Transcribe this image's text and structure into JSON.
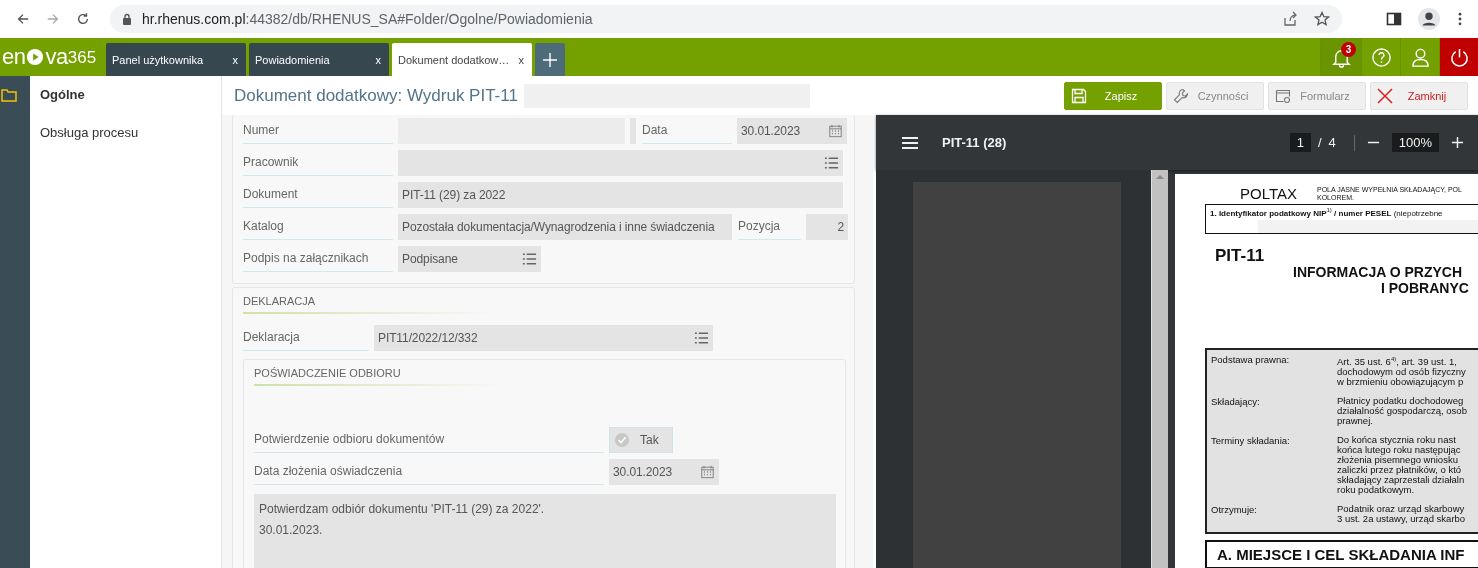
{
  "browser": {
    "url_host": "hr.rhenus.com.pl",
    "url_path": ":44382/db/RHENUS_SA#Folder/Ogolne/Powiadomienia"
  },
  "app_bar": {
    "logo": {
      "left": "en",
      "right": "va",
      "suffix": "365"
    },
    "tabs": [
      {
        "label": "Panel użytkownika",
        "close": "x",
        "selected": false
      },
      {
        "label": "Powiadomienia",
        "close": "x",
        "selected": false
      },
      {
        "label": "Dokument dodatkow…",
        "close": "x",
        "selected": true
      }
    ],
    "notifications": {
      "count": "3"
    }
  },
  "sidebar": {
    "items": [
      {
        "label": "Ogólne",
        "selected": true
      },
      {
        "label": "Obsługa procesu",
        "selected": false
      }
    ]
  },
  "header": {
    "title": "Dokument dodatkowy: Wydruk PIT-11",
    "buttons": [
      {
        "label": "Zapisz",
        "kind": "save"
      },
      {
        "label": "Czynności",
        "kind": "tools"
      },
      {
        "label": "Formularz",
        "kind": "form"
      },
      {
        "label": "Zamknij",
        "kind": "close"
      }
    ]
  },
  "form": {
    "rows": [
      [
        {
          "label": "Numer",
          "kind": "text"
        },
        {
          "label": "Data",
          "kind": "date",
          "value": "30.01.2023"
        }
      ],
      [
        {
          "label": "Pracownik",
          "kind": "lookup"
        }
      ],
      [
        {
          "label": "Dokument",
          "kind": "text",
          "value": "PIT-11 (29) za 2022"
        }
      ],
      [
        {
          "label": "Katalog",
          "kind": "text",
          "value": "Pozostała dokumentacja/Wynagrodzenia i inne świadczenia"
        },
        {
          "label": "Pozycja",
          "kind": "number",
          "value": "2"
        }
      ],
      [
        {
          "label": "Podpis na załącznikach",
          "kind": "lookup",
          "value": "Podpisane"
        }
      ]
    ],
    "declaration": {
      "title": "DEKLARACJA",
      "field": {
        "label": "Deklaracja",
        "kind": "lookup",
        "value": "PIT11/2022/12/332"
      },
      "receipt": {
        "title": "POŚWIADCZENIE ODBIORU",
        "fields": [
          {
            "label": "Potwierdzenie odbioru dokumentów",
            "kind": "checkbox",
            "value": "Tak",
            "checked": true
          },
          {
            "label": "Data złożenia oświadczenia",
            "kind": "date",
            "value": "30.01.2023"
          }
        ],
        "note": [
          "Potwierdzam odbiór dokumentu 'PIT-11 (29) za 2022'.",
          "30.01.2023."
        ]
      }
    }
  },
  "pdf_viewer": {
    "title": "PIT-11 (28)",
    "page": "1",
    "page_separator": "/",
    "page_total": "4",
    "zoom": "100%",
    "document": {
      "brand": "POLTAX",
      "note": [
        "POLA JASNE WYPEŁNIA SKŁADAJĄCY, POL",
        "KOLOREM."
      ],
      "id_line": "**1. Identyfikator podatkowy NIP**$^{1)}$ **/ numer PESEL** (niepotrzebne",
      "form_code": "PIT-11",
      "heading": [
        "INFORMACJA O PRZYCH",
        "I POBRANYC"
      ],
      "rows": [
        {
          "label": "Podstawa prawna:",
          "lines": [
            "Art. 35 ust. 6$^{4)}$, art. 39 ust. 1,",
            "dochodowym od osób fizyczny",
            "w brzmieniu obowiązującym p"
          ]
        },
        {
          "label": "Składający:",
          "lines": [
            "Płatnicy podatku dochodoweg",
            "działalność gospodarczą, osob",
            "prawnej."
          ]
        },
        {
          "label": "Terminy składania:",
          "lines": [
            "Do końca stycznia roku nast",
            "końca lutego roku następując",
            "złożenia pisemnego wniosku",
            "zaliczki przez płatników, o któ",
            "składający zaprzestali działaln",
            "roku podatkowym."
          ]
        },
        {
          "label": "Otrzymuje:",
          "lines": [
            "Podatnik oraz urząd skarbowy",
            "3 ust. 2a ustawy, urząd skarbo"
          ]
        }
      ],
      "section": "A. MIEJSCE I CEL SKŁADANIA INF"
    }
  }
}
